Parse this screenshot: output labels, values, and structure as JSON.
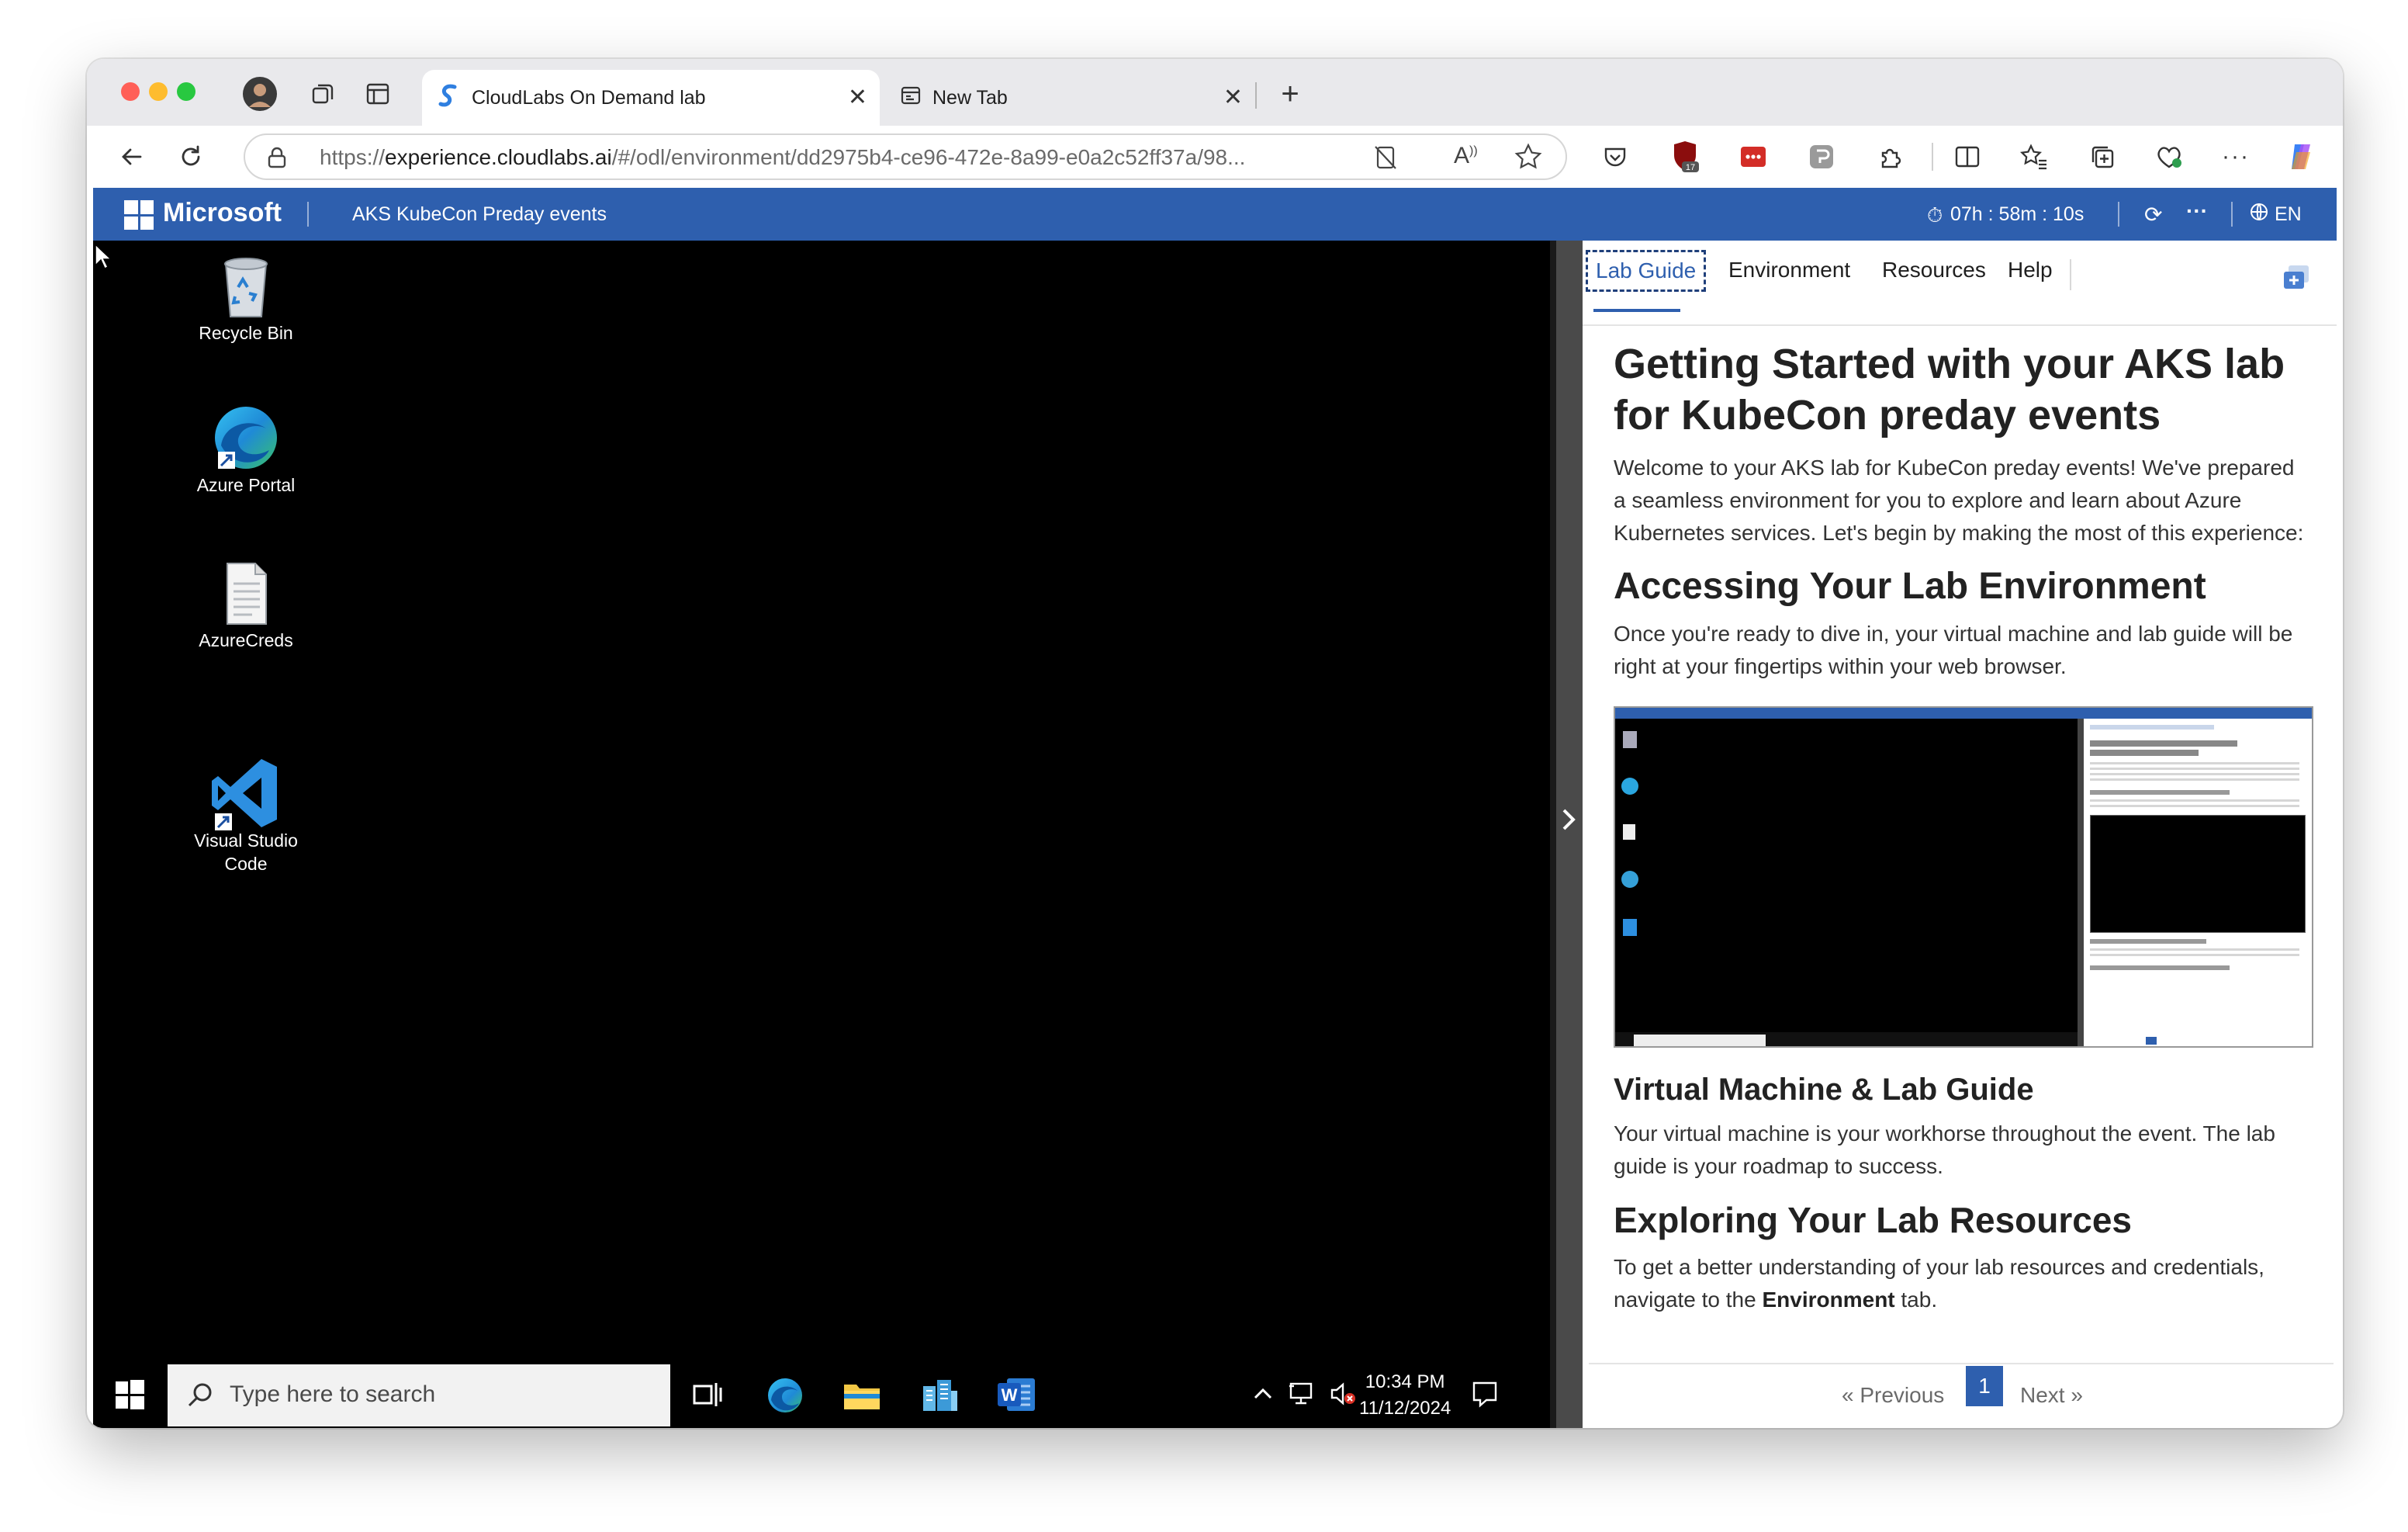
{
  "browser": {
    "tabs": [
      {
        "title": "CloudLabs On Demand lab",
        "active": true
      },
      {
        "title": "New Tab",
        "active": false
      }
    ],
    "url_prefix": "https://",
    "url_host": "experience.cloudlabs.ai",
    "url_path": "/#/odl/environment/dd2975b4-ce96-472e-8a99-e0a2c52ff37a/98...",
    "extension_badge": "17"
  },
  "header": {
    "brand": "Microsoft",
    "event_title": "AKS KubeCon Preday events",
    "timer": "07h : 58m : 10s",
    "language": "EN"
  },
  "desktop": {
    "icons": [
      {
        "label": "Recycle Bin",
        "icon": "recycle-bin-icon"
      },
      {
        "label": "Azure Portal",
        "icon": "edge-icon"
      },
      {
        "label": "AzureCreds",
        "icon": "document-icon"
      },
      {
        "label": "Visual Studio\nCode",
        "icon": "vscode-icon"
      }
    ],
    "taskbar": {
      "search_placeholder": "Type here to search",
      "time": "10:34 PM",
      "date": "11/12/2024"
    }
  },
  "lab_panel": {
    "tabs": [
      "Lab Guide",
      "Environment",
      "Resources",
      "Help"
    ],
    "active_tab": "Lab Guide",
    "title": "Getting Started with your AKS lab for KubeCon preday events",
    "intro": "Welcome to your AKS lab for KubeCon preday events! We've prepared a seamless environment for you to explore and learn about Azure Kubernetes services. Let's begin by making the most of this experience:",
    "section1_heading": "Accessing Your Lab Environment",
    "section1_text": "Once you're ready to dive in, your virtual machine and lab guide will be right at your fingertips within your web browser.",
    "section2_heading": "Virtual Machine & Lab Guide",
    "section2_text": "Your virtual machine is your workhorse throughout the event. The lab guide is your roadmap to success.",
    "section3_heading": "Exploring Your Lab Resources",
    "section3_text_before": "To get a better understanding of your lab resources and credentials, navigate to the ",
    "section3_text_bold": "Environment",
    "section3_text_after": " tab.",
    "pagination": {
      "previous": "« Previous",
      "current": "1",
      "next": "Next »"
    }
  },
  "colors": {
    "accent": "#2e5fae",
    "desktop_bg": "#000000",
    "tab_strip": "#e9e9ec"
  }
}
